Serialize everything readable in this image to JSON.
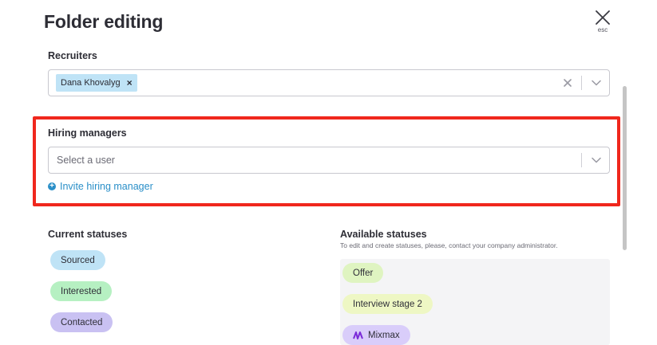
{
  "title": "Folder editing",
  "close": {
    "icon": "close-icon",
    "hint": "esc"
  },
  "recruiters": {
    "label": "Recruiters",
    "selected": [
      "Dana Khovalyg"
    ],
    "chip_remove": "×",
    "clear_icon": "clear-icon",
    "dropdown_icon": "chevron-down-icon"
  },
  "hiring_managers": {
    "label": "Hiring managers",
    "placeholder": "Select a user",
    "dropdown_icon": "chevron-down-icon",
    "invite_label": "Invite hiring manager",
    "invite_icon": "plus-circle-icon"
  },
  "current_statuses": {
    "label": "Current statuses",
    "items": [
      {
        "label": "Sourced",
        "color": "#bfe3f6"
      },
      {
        "label": "Interested",
        "color": "#b6f0c2"
      },
      {
        "label": "Contacted",
        "color": "#c9c1f2"
      }
    ]
  },
  "available_statuses": {
    "label": "Available statuses",
    "note": "To edit and create statuses, please, contact your company administrator.",
    "items": [
      {
        "label": "Offer",
        "color": "#dff4c1"
      },
      {
        "label": "Interview stage 2",
        "color": "#eef7c4"
      },
      {
        "label": "Mixmax",
        "color": "#d9cdfa",
        "icon": "mixmax-logo-icon"
      }
    ]
  },
  "colors": {
    "highlight": "#f0271d",
    "link": "#2a8fc8",
    "title": "#2d2d35"
  }
}
